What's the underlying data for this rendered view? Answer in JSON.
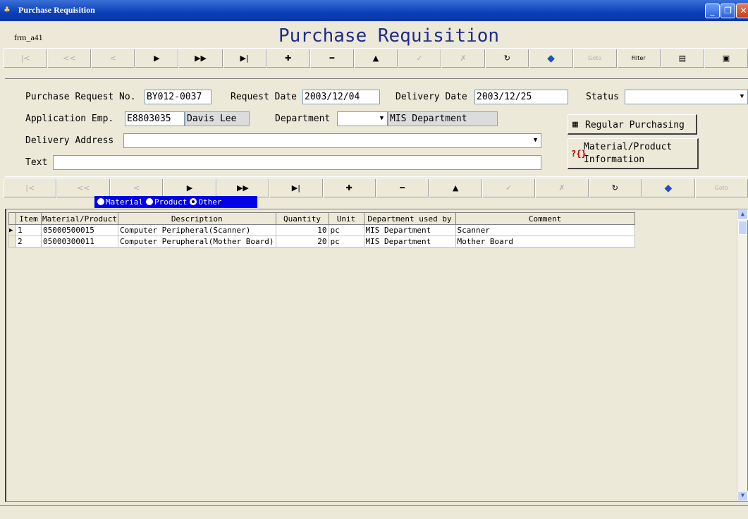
{
  "window": {
    "title": "Purchase Requisition",
    "buttons": {
      "minimize": "_",
      "restore": "❐",
      "close": "✕"
    }
  },
  "form_id": "frm_a41",
  "page_title": "Purchase Requisition",
  "toolbar_top": {
    "buttons": [
      {
        "name": "first",
        "glyph": "|<",
        "enabled": false
      },
      {
        "name": "prev-page",
        "glyph": "<<",
        "enabled": false
      },
      {
        "name": "prev",
        "glyph": "<",
        "enabled": false
      },
      {
        "name": "next",
        "glyph": "▶",
        "enabled": true
      },
      {
        "name": "next-page",
        "glyph": "▶▶",
        "enabled": true
      },
      {
        "name": "last",
        "glyph": "▶|",
        "enabled": true
      },
      {
        "name": "add",
        "glyph": "✚",
        "enabled": true
      },
      {
        "name": "delete",
        "glyph": "━",
        "enabled": true
      },
      {
        "name": "edit",
        "glyph": "▲",
        "enabled": true
      },
      {
        "name": "post",
        "glyph": "✓",
        "enabled": false
      },
      {
        "name": "cancel",
        "glyph": "✗",
        "enabled": false
      },
      {
        "name": "refresh",
        "glyph": "↻",
        "enabled": true
      },
      {
        "name": "tag",
        "glyph": "◆",
        "enabled": true
      },
      {
        "name": "goto",
        "glyph": "Goto",
        "enabled": false
      },
      {
        "name": "filter",
        "glyph": "Filter",
        "enabled": true
      },
      {
        "name": "report",
        "glyph": "▤",
        "enabled": true
      },
      {
        "name": "save",
        "glyph": "▣",
        "enabled": true
      }
    ]
  },
  "header": {
    "request_no_label": "Purchase Request No.",
    "request_no": "BY012-0037",
    "request_date_label": "Request Date",
    "request_date": "2003/12/04",
    "delivery_date_label": "Delivery Date",
    "delivery_date": "2003/12/25",
    "status_label": "Status",
    "status": "",
    "application_emp_label": "Application Emp.",
    "application_emp": "E8803035",
    "emp_name": "Davis Lee",
    "department_label": "Department",
    "department_code": "",
    "department_name": "MIS Department",
    "delivery_address_label": "Delivery Address",
    "delivery_address": "",
    "text_label": "Text",
    "text": "",
    "regular_purchasing_label": "Regular Purchasing",
    "material_info_label_1": "Material/Product",
    "material_info_label_2": "Information"
  },
  "toolbar_detail": {
    "buttons": [
      {
        "name": "first",
        "glyph": "|<",
        "enabled": false
      },
      {
        "name": "prev-page",
        "glyph": "<<",
        "enabled": false
      },
      {
        "name": "prev",
        "glyph": "<",
        "enabled": false
      },
      {
        "name": "next",
        "glyph": "▶",
        "enabled": true
      },
      {
        "name": "next-page",
        "glyph": "▶▶",
        "enabled": true
      },
      {
        "name": "last",
        "glyph": "▶|",
        "enabled": true
      },
      {
        "name": "add",
        "glyph": "✚",
        "enabled": true
      },
      {
        "name": "delete",
        "glyph": "━",
        "enabled": true
      },
      {
        "name": "edit",
        "glyph": "▲",
        "enabled": true
      },
      {
        "name": "post",
        "glyph": "✓",
        "enabled": false
      },
      {
        "name": "cancel",
        "glyph": "✗",
        "enabled": false
      },
      {
        "name": "refresh",
        "glyph": "↻",
        "enabled": true
      },
      {
        "name": "tag",
        "glyph": "◆",
        "enabled": true
      },
      {
        "name": "goto",
        "glyph": "Goto",
        "enabled": false
      }
    ]
  },
  "item_type": {
    "options": [
      "Material",
      "Product",
      "Other"
    ],
    "selected": "Other"
  },
  "grid": {
    "columns": [
      "Item",
      "Material/Product",
      "Description",
      "Quantity",
      "Unit",
      "Department used by",
      "Comment"
    ],
    "rows": [
      {
        "item": "1",
        "material": "05000500015",
        "description": "Computer Peripheral(Scanner)",
        "quantity": "10",
        "unit": "pc",
        "department": "MIS Department",
        "comment": "Scanner",
        "current": true
      },
      {
        "item": "2",
        "material": "05000300011",
        "description": "Computer Perupheral(Mother Board)",
        "quantity": "20",
        "unit": "pc",
        "department": "MIS Department",
        "comment": "Mother Board",
        "current": false
      }
    ]
  },
  "colors": {
    "title_bar": "#0a3fb9",
    "page_title": "#1f2c8c",
    "radio_bar": "#0000e8",
    "window_bg": "#ece9d8"
  }
}
